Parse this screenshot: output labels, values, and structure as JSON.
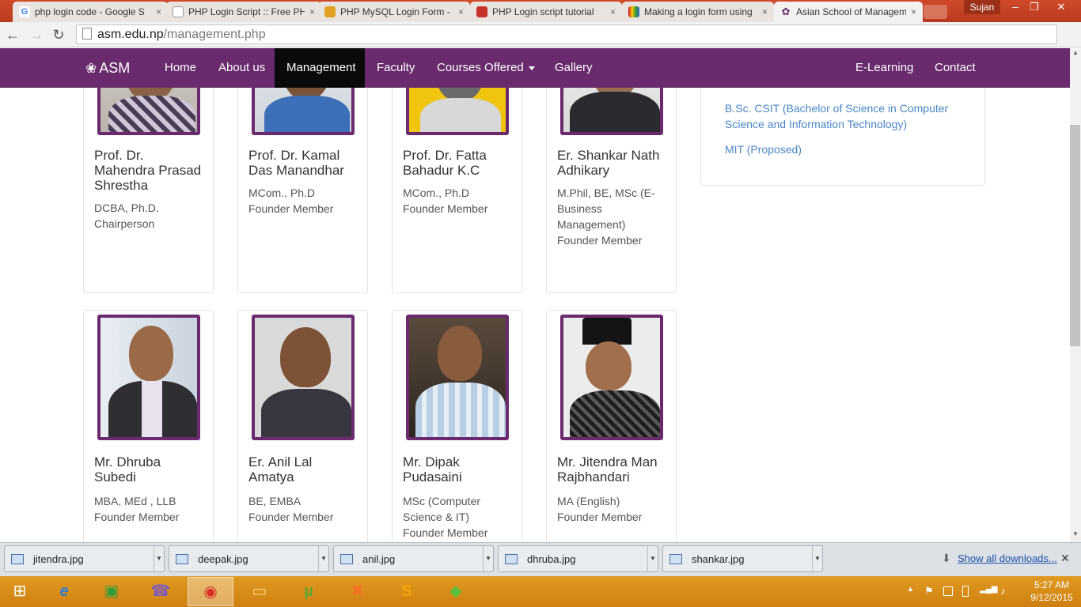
{
  "browser": {
    "tabs": [
      {
        "label": "php login code - Google S",
        "favicon_color": "#ffffff",
        "favicon_glyph": "G"
      },
      {
        "label": "PHP Login Script :: Free PH",
        "favicon_color": "#ffffff",
        "favicon_glyph": ""
      },
      {
        "label": "PHP MySQL Login Form - ",
        "favicon_color": "#e0a020",
        "favicon_glyph": ""
      },
      {
        "label": "PHP Login script tutorial",
        "favicon_color": "#c8322a",
        "favicon_glyph": ""
      },
      {
        "label": "Making a login form using",
        "favicon_color": "#8a4bbf",
        "favicon_glyph": ""
      },
      {
        "label": "Asian School of Managem",
        "favicon_color": "#6a2a6e",
        "favicon_glyph": "✿"
      }
    ],
    "close_glyph": "×",
    "user": "Sujan",
    "window_controls": {
      "minimize": "–",
      "restore": "❐",
      "close": "✕"
    },
    "nav": {
      "back": "←",
      "forward": "→",
      "reload": "↻"
    },
    "url_host": "asm.edu.np",
    "url_path": "/management.php",
    "star": "☆",
    "menu": "≡"
  },
  "site": {
    "brand": "ASM",
    "brand_logo": "❀",
    "nav_left": [
      {
        "label": "Home"
      },
      {
        "label": "About us"
      },
      {
        "label": "Management"
      },
      {
        "label": "Faculty"
      },
      {
        "label": "Courses Offered"
      },
      {
        "label": "Gallery"
      }
    ],
    "nav_right": [
      {
        "label": "E-Learning"
      },
      {
        "label": "Contact"
      }
    ],
    "active_nav": "Management",
    "accent_color": "#6a2a6e",
    "link_color": "#4a86c5"
  },
  "members": [
    {
      "name": "Prof. Dr. Mahendra Prasad Shrestha",
      "qual": "DCBA, Ph.D.",
      "role": "Chairperson"
    },
    {
      "name": "Prof. Dr. Kamal Das Manandhar",
      "qual": "MCom., Ph.D",
      "role": "Founder Member"
    },
    {
      "name": "Prof. Dr. Fatta Bahadur K.C",
      "qual": "MCom., Ph.D",
      "role": "Founder Member"
    },
    {
      "name": "Er. Shankar Nath Adhikary",
      "qual": "M.Phil, BE, MSc (E-Business Management)",
      "role": "Founder Member"
    },
    {
      "name": "Mr. Dhruba Subedi",
      "qual": "MBA, MEd , LLB",
      "role": "Founder Member"
    },
    {
      "name": "Er. Anil Lal Amatya",
      "qual": "BE, EMBA",
      "role": "Founder Member"
    },
    {
      "name": "Mr. Dipak Pudasaini",
      "qual": "MSc (Computer Science & IT)",
      "role": "Founder Member"
    },
    {
      "name": "Mr. Jitendra Man Rajbhandari",
      "qual": "MA (English)",
      "role": "Founder Member"
    }
  ],
  "courses_panel": {
    "links": [
      {
        "label": "B.Sc. CSIT (Bachelor of Science in Computer Science and Information Technology)"
      },
      {
        "label": "MIT (Proposed)"
      }
    ]
  },
  "downloads": {
    "files": [
      {
        "name": "jitendra.jpg"
      },
      {
        "name": "deepak.jpg"
      },
      {
        "name": "anil.jpg"
      },
      {
        "name": "dhruba.jpg"
      },
      {
        "name": "shankar.jpg"
      }
    ],
    "show_all": "Show all downloads...",
    "dropdown_glyph": "▼",
    "download_glyph": "⬇",
    "close_glyph": "✕"
  },
  "taskbar": {
    "apps": [
      {
        "name": "start-icon",
        "glyph": "⊞"
      },
      {
        "name": "internet-explorer-icon",
        "glyph": "e"
      },
      {
        "name": "store-icon",
        "glyph": "▣"
      },
      {
        "name": "viber-icon",
        "glyph": "☎"
      },
      {
        "name": "chrome-icon",
        "glyph": "◉"
      },
      {
        "name": "file-explorer-icon",
        "glyph": "▭"
      },
      {
        "name": "utorrent-icon",
        "glyph": "µ"
      },
      {
        "name": "xampp-icon",
        "glyph": "✖"
      },
      {
        "name": "sublime-icon",
        "glyph": "S"
      },
      {
        "name": "bluestacks-icon",
        "glyph": "◆"
      }
    ],
    "time": "5:27 AM",
    "date": "9/12/2015",
    "tray_glyphs": {
      "chevron": "▲",
      "flag": "⚑",
      "speaker": "♪",
      "signal": "▂▄▆"
    }
  }
}
